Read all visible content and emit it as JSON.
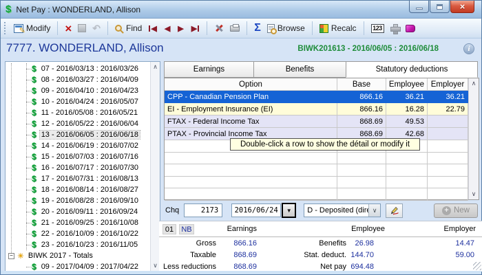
{
  "window": {
    "title": "Net Pay : WONDERLAND, Allison"
  },
  "toolbar": {
    "modify": "Modify",
    "find": "Find",
    "browse": "Browse",
    "recalc": "Recalc",
    "calc_badge": "123"
  },
  "header": {
    "employee_title": "7777. WONDERLAND, Allison",
    "period": "BIWK201613 - 2016/06/05 : 2016/06/18"
  },
  "tree": {
    "items": [
      "07 - 2016/03/13 : 2016/03/26",
      "08 - 2016/03/27 : 2016/04/09",
      "09 - 2016/04/10 : 2016/04/23",
      "10 - 2016/04/24 : 2016/05/07",
      "11 - 2016/05/08 : 2016/05/21",
      "12 - 2016/05/22 : 2016/06/04",
      "13 - 2016/06/05 : 2016/06/18",
      "14 - 2016/06/19 : 2016/07/02",
      "15 - 2016/07/03 : 2016/07/16",
      "16 - 2016/07/17 : 2016/07/30",
      "17 - 2016/07/31 : 2016/08/13",
      "18 - 2016/08/14 : 2016/08/27",
      "19 - 2016/08/28 : 2016/09/10",
      "20 - 2016/09/11 : 2016/09/24",
      "21 - 2016/09/25 : 2016/10/08",
      "22 - 2016/10/09 : 2016/10/22",
      "23 - 2016/10/23 : 2016/11/05"
    ],
    "selected_item": "13 - 2016/06/05 : 2016/06/18",
    "totals_label": "BIWK 2017 - Totals",
    "totals_child": "09 - 2017/04/09 : 2017/04/22"
  },
  "tabs": {
    "earnings": "Earnings",
    "benefits": "Benefits",
    "statutory": "Statutory deductions",
    "active": "Statutory deductions"
  },
  "table": {
    "columns": {
      "option": "Option",
      "base": "Base",
      "employee": "Employee",
      "employer": "Employer"
    },
    "rows": [
      {
        "option": "CPP - Canadian Pension Plan",
        "base": "866.16",
        "employee": "36.21",
        "employer": "36.21",
        "state": "selected"
      },
      {
        "option": "EI - Employment Insurance (EI)",
        "base": "866.16",
        "employee": "16.28",
        "employer": "22.79",
        "state": "highlighted"
      },
      {
        "option": "FTAX - Federal Income Tax",
        "base": "868.69",
        "employee": "49.53",
        "employer": "",
        "state": "normal"
      },
      {
        "option": "PTAX - Provincial Income Tax",
        "base": "868.69",
        "employee": "42.68",
        "employer": "",
        "state": "normal"
      }
    ],
    "tooltip": "Double-click a row to show the détail or modify it"
  },
  "cheque": {
    "label": "Chq",
    "number": "2173",
    "date": "2016/06/24",
    "deposit_type": "D - Deposited (dire",
    "new_label": "New"
  },
  "summary": {
    "code": "01",
    "province": "NB",
    "headers": {
      "earnings": "Earnings",
      "employee": "Employee",
      "employer": "Employer"
    },
    "rows": [
      {
        "label": "Gross",
        "earnings": "866.16",
        "label2": "Benefits",
        "employee": "26.98",
        "employer": "14.47"
      },
      {
        "label": "Taxable",
        "earnings": "868.69",
        "label2": "Stat. deduct.",
        "employee": "144.70",
        "employer": "59.00"
      },
      {
        "label": "Less reductions",
        "earnings": "868.69",
        "label2": "Net pay",
        "employee": "694.48",
        "employer": ""
      }
    ]
  },
  "icons": {
    "dollar": "$",
    "sigma": "Σ",
    "info": "i",
    "sun": "☀",
    "expander_minus": "−",
    "nav_prev": "◀",
    "nav_next": "▶",
    "dropdown_arrow": "▼",
    "chevron_down": "∨",
    "scroll_up": "∧",
    "scroll_down": "∨",
    "pencil": "✎",
    "undo": "↶",
    "close_x": "×"
  },
  "colors": {
    "selected_row": "#1563D5",
    "highlight_row": "#FFFCD9",
    "alt_row": "#E4E4F6",
    "period_text": "#1E8C3A",
    "value_text": "#1C2F9E",
    "title_text": "#1C3799"
  }
}
